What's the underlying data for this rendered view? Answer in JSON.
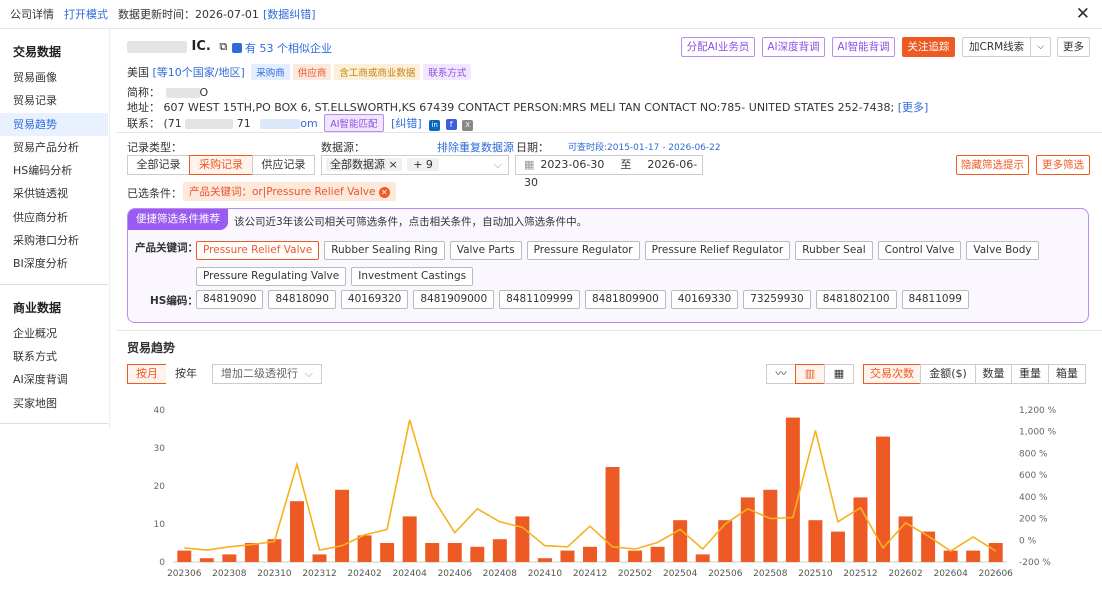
{
  "topbar": {
    "title": "公司详情",
    "open_mode": "打开模式",
    "update_label": "数据更新时间：2026-07-01",
    "error_link": "[数据纠错]"
  },
  "sidebar": {
    "section1_title": "交易数据",
    "items1": [
      {
        "label": "贸易画像"
      },
      {
        "label": "贸易记录"
      },
      {
        "label": "贸易趋势"
      },
      {
        "label": "贸易产品分析"
      },
      {
        "label": "HS编码分析"
      },
      {
        "label": "采供链透视"
      },
      {
        "label": "供应商分析"
      },
      {
        "label": "采购港口分析"
      },
      {
        "label": "BI深度分析"
      }
    ],
    "section2_title": "商业数据",
    "items2": [
      {
        "label": "企业概况"
      },
      {
        "label": "联系方式"
      },
      {
        "label": "AI深度背调"
      },
      {
        "label": "买家地图"
      }
    ]
  },
  "company": {
    "name_suffix": "IC.",
    "similar": "有 53 个相似企业",
    "country": "美国",
    "country_more": "[等10个国家/地区]",
    "tags": [
      "采购商",
      "供应商",
      "含工商或商业数据",
      "联系方式"
    ],
    "short_label": "简称：",
    "short_suffix": "O",
    "address_label": "地址：",
    "address": "607 WEST 15TH,PO BOX 6, ST.ELLSWORTH,KS 67439 CONTACT PERSON:MRS MELI TAN CONTACT NO:785- UNITED STATES 252-7438;",
    "more": "[更多]",
    "contact_label": "联系：",
    "contact_prefix": "(71",
    "contact_mid": "71",
    "contact_om": "om",
    "ai_match": "AI智能匹配",
    "correct": "[纠错]",
    "social": [
      "in",
      "f",
      "X"
    ]
  },
  "actions": {
    "assign": "分配AI业务员",
    "deep": "AI深度背调",
    "smart": "AI智能背调",
    "follow": "关注追踪",
    "crm": "加CRM线索",
    "more": "更多"
  },
  "filters": {
    "record_type_label": "记录类型：",
    "record_types": [
      "全部记录",
      "采购记录",
      "供应记录"
    ],
    "source_label": "数据源：",
    "source_value": "全部数据源",
    "source_count": "+ 9",
    "dedupe": "排除重复数据源",
    "date_label": "日期：",
    "date_range_hint": "可查时段:2015-01-17 - 2026-06-22",
    "date_start": "2023-06-30",
    "date_to": "至",
    "date_end": "2026-06-30",
    "hidden_tip": "隐藏筛选提示",
    "more_filter": "更多筛选",
    "selected_label": "已选条件：",
    "selected_chip": "产品关键词：or|Pressure Relief Valve"
  },
  "suggest": {
    "badge": "便捷筛选条件推荐",
    "desc": "该公司近3年该公司相关可筛选条件，点击相关条件，自动加入筛选条件中。",
    "kw_label": "产品关键词：",
    "keywords": [
      "Pressure Relief Valve",
      "Rubber Sealing Ring",
      "Valve Parts",
      "Pressure Regulator",
      "Pressure Relief Regulator",
      "Rubber Seal",
      "Control Valve",
      "Valve Body",
      "Pressure Regulating Valve",
      "Investment Castings"
    ],
    "hs_label": "HS编码：",
    "hs_codes": [
      "84819090",
      "84818090",
      "40169320",
      "8481909000",
      "8481109999",
      "8481809900",
      "40169330",
      "73259930",
      "8481802100",
      "84811099"
    ]
  },
  "trend": {
    "title": "贸易趋势",
    "period_tabs": [
      "按月",
      "按年"
    ],
    "pivot_placeholder": "增加二级透视行",
    "metric_tabs": [
      "交易次数",
      "金额($)",
      "数量",
      "重量",
      "箱量"
    ]
  },
  "colors": {
    "accent": "#ee5a24",
    "bar": "#ee5a24",
    "line": "#f5b21f",
    "link": "#2f6bd9",
    "purple": "#8f4fe0"
  },
  "chart_data": {
    "type": "bar",
    "x": [
      "202306",
      "202307",
      "202308",
      "202309",
      "202310",
      "202311",
      "202312",
      "202401",
      "202402",
      "202403",
      "202404",
      "202405",
      "202406",
      "202407",
      "202408",
      "202409",
      "202410",
      "202411",
      "202412",
      "202501",
      "202502",
      "202503",
      "202504",
      "202505",
      "202506",
      "202507",
      "202508",
      "202509",
      "202510",
      "202511",
      "202512",
      "202601",
      "202602",
      "202603",
      "202604",
      "202605",
      "202606"
    ],
    "xticks": [
      "202306",
      "202308",
      "202310",
      "202312",
      "202402",
      "202404",
      "202406",
      "202408",
      "202410",
      "202412",
      "202502",
      "202504",
      "202506",
      "202508",
      "202510",
      "202512",
      "202602",
      "202604",
      "202606"
    ],
    "series": [
      {
        "values": [
          3,
          1,
          2,
          5,
          6,
          16,
          2,
          19,
          7,
          5,
          12,
          5,
          5,
          4,
          6,
          12,
          1,
          3,
          4,
          25,
          3,
          4,
          11,
          2,
          11,
          17,
          19,
          38,
          11,
          8,
          17,
          33,
          12,
          8,
          3,
          3,
          5
        ]
      },
      {
        "values": [
          -70,
          -90,
          -60,
          -40,
          -10,
          700,
          -90,
          -50,
          50,
          100,
          1110,
          400,
          70,
          290,
          170,
          120,
          -50,
          -60,
          130,
          -60,
          -80,
          -20,
          100,
          -80,
          150,
          290,
          200,
          210,
          1010,
          170,
          300,
          -70,
          160,
          40,
          -100,
          30,
          -100
        ]
      }
    ],
    "ylim": [
      0,
      40
    ],
    "yticks": [
      0,
      10,
      20,
      30,
      40
    ],
    "y2lim": [
      -200,
      1200
    ],
    "y2ticks": [
      "-200 %",
      "0 %",
      "200 %",
      "400 %",
      "600 %",
      "800 %",
      "1,000 %",
      "1,200 %"
    ],
    "grid": false
  }
}
